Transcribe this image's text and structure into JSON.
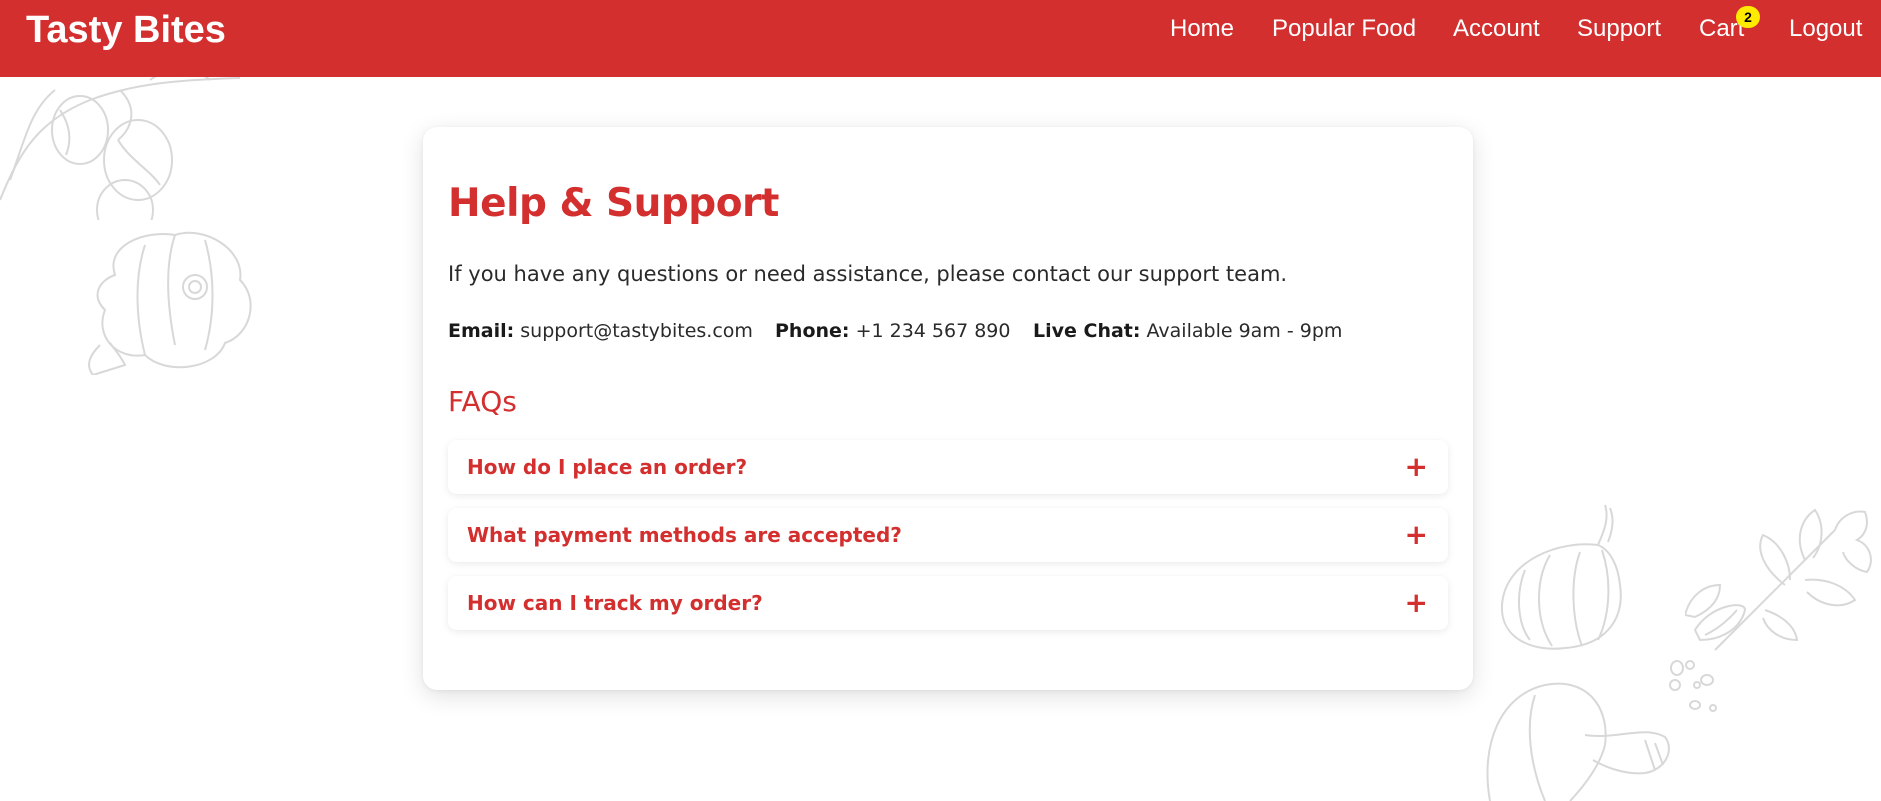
{
  "navbar": {
    "brand": "Tasty Bites",
    "links": {
      "home": "Home",
      "popular_food": "Popular Food",
      "account": "Account",
      "support": "Support",
      "cart": "Cart",
      "logout": "Logout"
    },
    "cart_count": "2"
  },
  "support": {
    "title": "Help & Support",
    "intro": "If you have any questions or need assistance, please contact our support team.",
    "contacts": {
      "email_label": "Email:",
      "email_value": "support@tastybites.com",
      "phone_label": "Phone:",
      "phone_value": "+1 234 567 890",
      "chat_label": "Live Chat:",
      "chat_value": "Available 9am - 9pm"
    },
    "faq_heading": "FAQs",
    "faqs": [
      {
        "question": "How do I place an order?",
        "toggle": "+"
      },
      {
        "question": "What payment methods are accepted?",
        "toggle": "+"
      },
      {
        "question": "How can I track my order?",
        "toggle": "+"
      }
    ]
  },
  "colors": {
    "brand_red": "#d32f2f",
    "badge_yellow": "#ffeb00",
    "doodle_gray": "#d6d6d6"
  },
  "decorations": [
    "vegetable-doodle-top-left",
    "squash-doodle-left",
    "garlic-doodle-right",
    "herb-doodle-right",
    "mushroom-doodle-bottom-right"
  ]
}
